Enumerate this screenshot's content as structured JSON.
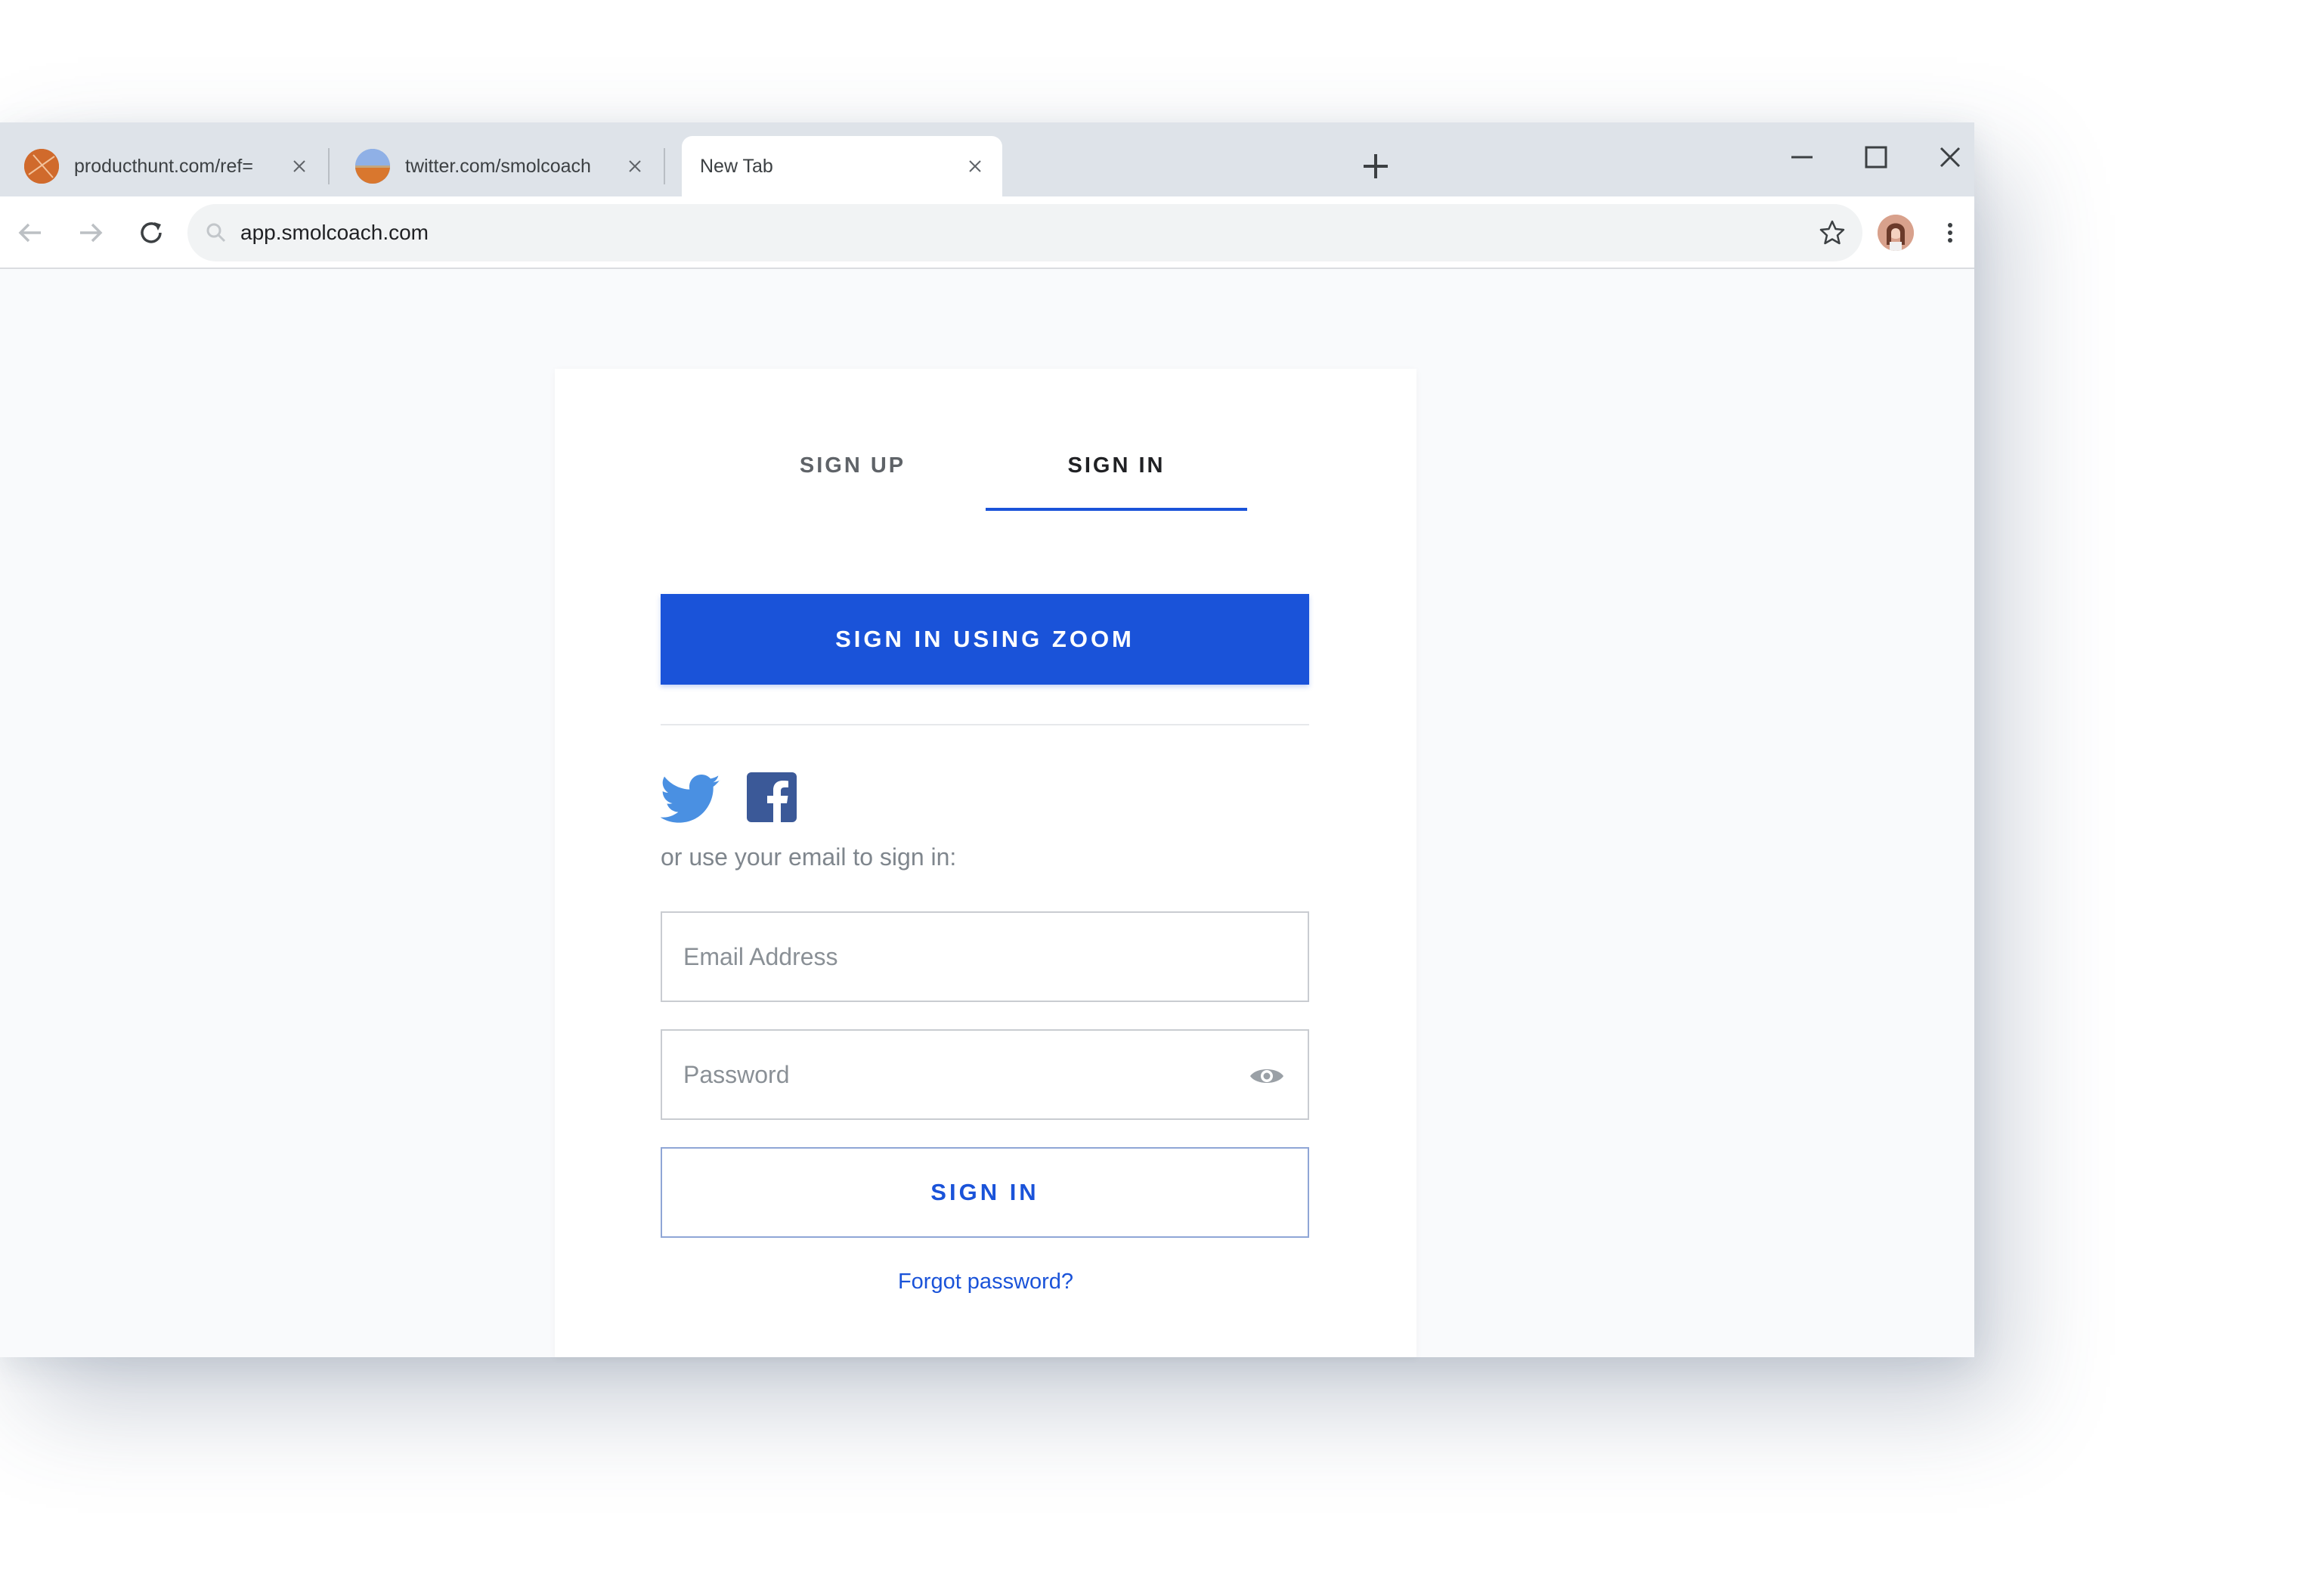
{
  "browser": {
    "tabs": [
      {
        "title": "producthunt.com/ref=",
        "favicon": "producthunt-favicon",
        "active": false
      },
      {
        "title": "twitter.com/smolcoach",
        "favicon": "twitter-avatar-favicon",
        "active": false
      },
      {
        "title": "New Tab",
        "favicon": "",
        "active": true
      }
    ],
    "address_bar": {
      "url": "app.smolcoach.com"
    }
  },
  "auth": {
    "tabs": {
      "sign_up": "SIGN UP",
      "sign_in": "SIGN IN",
      "active": "sign_in"
    },
    "zoom_button": "SIGN IN USING ZOOM",
    "social_icons": [
      "twitter-icon",
      "facebook-icon"
    ],
    "email_hint": "or use your email to sign in:",
    "email_placeholder": "Email Address",
    "password_placeholder": "Password",
    "submit_label": "SIGN IN",
    "forgot_link": "Forgot password?"
  },
  "colors": {
    "accent": "#1a53d9",
    "tabstrip": "#dee3e9",
    "page_background": "#f9fafc"
  }
}
